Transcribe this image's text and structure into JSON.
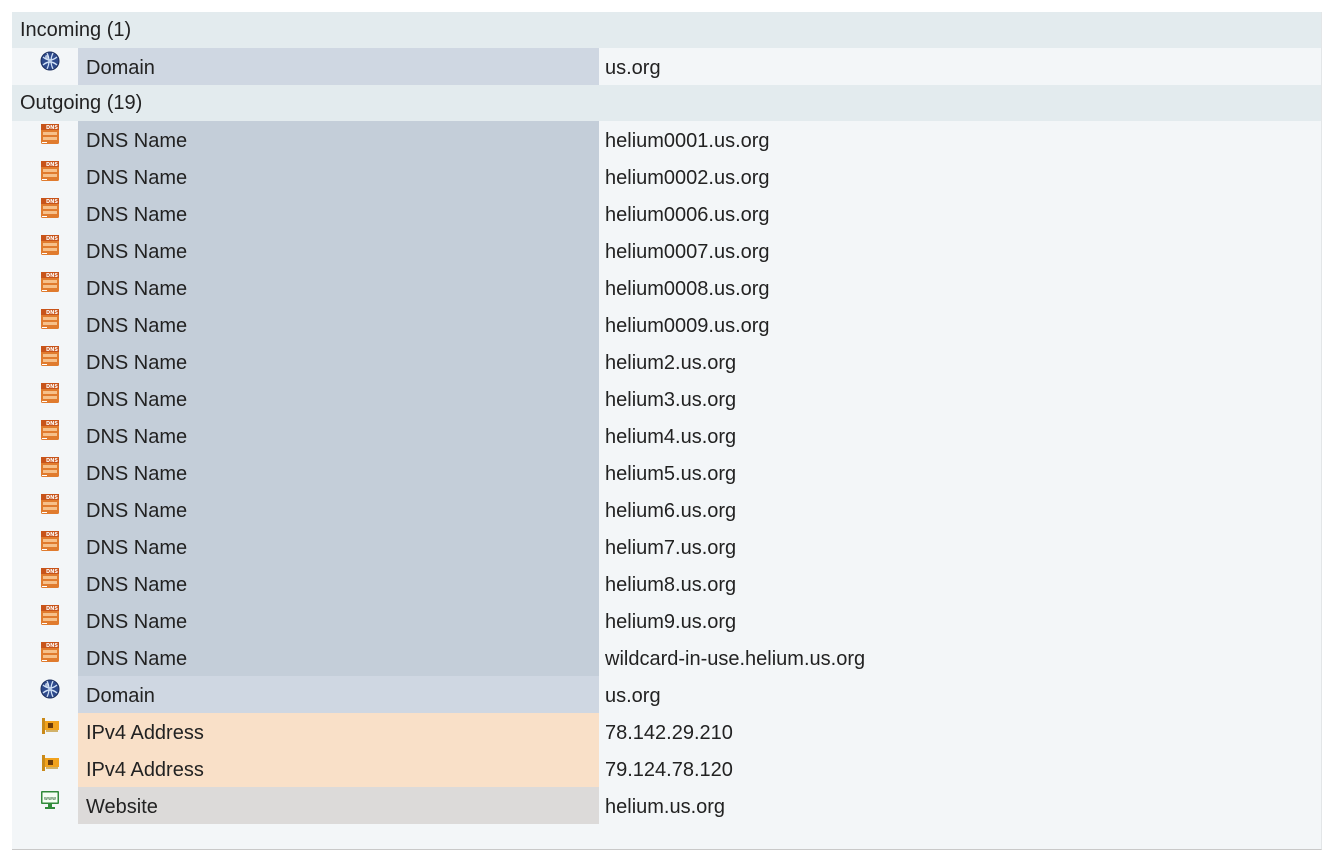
{
  "incoming": {
    "header": "Incoming (1)",
    "rows": [
      {
        "type": "Domain",
        "value": "us.org",
        "icon": "globe-icon",
        "kind": "domain"
      }
    ]
  },
  "outgoing": {
    "header": "Outgoing (19)",
    "rows": [
      {
        "type": "DNS Name",
        "value": "helium0001.us.org",
        "icon": "dns-server-icon",
        "kind": "dns"
      },
      {
        "type": "DNS Name",
        "value": "helium0002.us.org",
        "icon": "dns-server-icon",
        "kind": "dns"
      },
      {
        "type": "DNS Name",
        "value": "helium0006.us.org",
        "icon": "dns-server-icon",
        "kind": "dns"
      },
      {
        "type": "DNS Name",
        "value": "helium0007.us.org",
        "icon": "dns-server-icon",
        "kind": "dns"
      },
      {
        "type": "DNS Name",
        "value": "helium0008.us.org",
        "icon": "dns-server-icon",
        "kind": "dns"
      },
      {
        "type": "DNS Name",
        "value": "helium0009.us.org",
        "icon": "dns-server-icon",
        "kind": "dns"
      },
      {
        "type": "DNS Name",
        "value": "helium2.us.org",
        "icon": "dns-server-icon",
        "kind": "dns"
      },
      {
        "type": "DNS Name",
        "value": "helium3.us.org",
        "icon": "dns-server-icon",
        "kind": "dns"
      },
      {
        "type": "DNS Name",
        "value": "helium4.us.org",
        "icon": "dns-server-icon",
        "kind": "dns"
      },
      {
        "type": "DNS Name",
        "value": "helium5.us.org",
        "icon": "dns-server-icon",
        "kind": "dns"
      },
      {
        "type": "DNS Name",
        "value": "helium6.us.org",
        "icon": "dns-server-icon",
        "kind": "dns"
      },
      {
        "type": "DNS Name",
        "value": "helium7.us.org",
        "icon": "dns-server-icon",
        "kind": "dns"
      },
      {
        "type": "DNS Name",
        "value": "helium8.us.org",
        "icon": "dns-server-icon",
        "kind": "dns"
      },
      {
        "type": "DNS Name",
        "value": "helium9.us.org",
        "icon": "dns-server-icon",
        "kind": "dns"
      },
      {
        "type": "DNS Name",
        "value": "wildcard-in-use.helium.us.org",
        "icon": "dns-server-icon",
        "kind": "dns"
      },
      {
        "type": "Domain",
        "value": "us.org",
        "icon": "globe-icon",
        "kind": "domain"
      },
      {
        "type": "IPv4 Address",
        "value": "78.142.29.210",
        "icon": "network-card-icon",
        "kind": "ipv4"
      },
      {
        "type": "IPv4 Address",
        "value": "79.124.78.120",
        "icon": "network-card-icon",
        "kind": "ipv4"
      },
      {
        "type": "Website",
        "value": "helium.us.org",
        "icon": "www-monitor-icon",
        "kind": "website"
      }
    ]
  },
  "colors": {
    "section_header_bg": "#e3ebee",
    "panel_bg": "#f3f6f8",
    "domain_bg": "#cfd7e2",
    "dns_bg": "#c4ced9",
    "ipv4_bg": "#f9e0c8",
    "website_bg": "#dcdad9"
  }
}
